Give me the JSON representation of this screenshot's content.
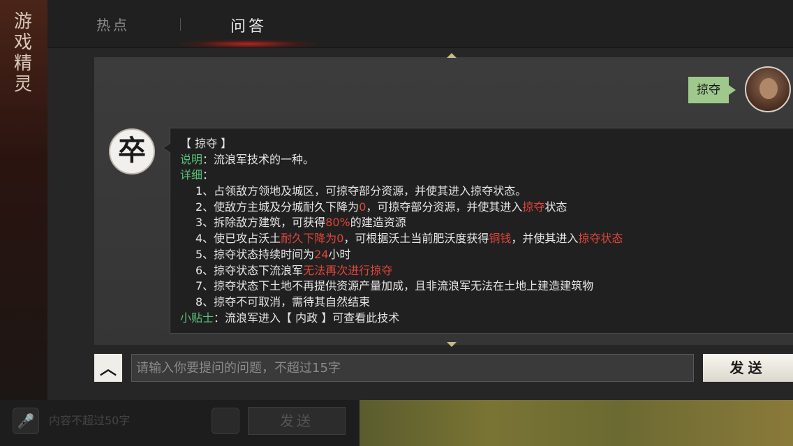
{
  "left_panel": {
    "title": [
      "游",
      "戏",
      "精",
      "灵"
    ]
  },
  "tabs": [
    {
      "label": "热点",
      "active": false
    },
    {
      "label": "问答",
      "active": true
    }
  ],
  "user_message": {
    "text": "掠夺"
  },
  "bot": {
    "avatar_char": "卒",
    "lines": [
      [
        {
          "t": "【 掠夺 】"
        }
      ],
      [
        {
          "t": "说明",
          "c": "green"
        },
        {
          "t": "：流浪军技术的一种。"
        }
      ],
      [
        {
          "t": "详细",
          "c": "green"
        },
        {
          "t": "："
        }
      ],
      [
        {
          "t": "1、占领敌方领地及城区，可掠夺部分资源，并使其进入掠夺状态。"
        }
      ],
      [
        {
          "t": "2、使敌方主城及分城耐久下降为"
        },
        {
          "t": "0",
          "c": "red"
        },
        {
          "t": "，可掠夺部分资源，并使其进入"
        },
        {
          "t": "掠夺",
          "c": "red"
        },
        {
          "t": "状态"
        }
      ],
      [
        {
          "t": "3、拆除敌方建筑，可获得"
        },
        {
          "t": "80%",
          "c": "red"
        },
        {
          "t": "的建造资源"
        }
      ],
      [
        {
          "t": "4、使已攻占沃土"
        },
        {
          "t": "耐久下降为0",
          "c": "red"
        },
        {
          "t": "，可根据沃土当前肥沃度获得"
        },
        {
          "t": "铜钱",
          "c": "red"
        },
        {
          "t": "，并使其进入"
        },
        {
          "t": "掠夺状态",
          "c": "red"
        }
      ],
      [
        {
          "t": "5、掠夺状态持续时间为"
        },
        {
          "t": "24",
          "c": "red"
        },
        {
          "t": "小时"
        }
      ],
      [
        {
          "t": "6、掠夺状态下流浪军"
        },
        {
          "t": "无法再次进行掠夺",
          "c": "red"
        }
      ],
      [
        {
          "t": "7、掠夺状态下土地不再提供资源产量加成，且非流浪军无法在土地上建造建筑物"
        }
      ],
      [
        {
          "t": "8、掠夺不可取消，需待其自然结束"
        }
      ],
      [
        {
          "t": "小贴士",
          "c": "green"
        },
        {
          "t": "：流浪军进入【 内政 】可查看此技术"
        }
      ]
    ],
    "indented_lines": [
      3,
      4,
      5,
      6,
      7,
      8,
      9,
      10
    ]
  },
  "input": {
    "placeholder": "请输入你要提问的问题，不超过15字",
    "value": "",
    "expand_icon": "chevron-up-icon"
  },
  "send_label": "发送",
  "background_bar": {
    "mic_icon": "microphone-icon",
    "placeholder": "内容不超过50字",
    "emoji_icon": "emoji-icon",
    "send_label": "发送"
  },
  "colors": {
    "highlight_green": "#56c27a",
    "highlight_red": "#e0453a",
    "user_bubble": "#9fc98c",
    "tab_glow": "#be281e"
  }
}
